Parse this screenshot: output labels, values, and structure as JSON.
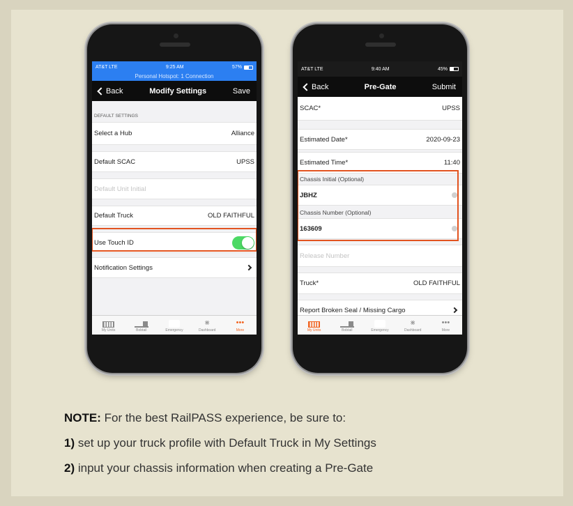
{
  "left_phone": {
    "status": {
      "carrier": "AT&T  LTE",
      "time": "9:25 AM",
      "battery_text": "57%",
      "battery_level": 0.57,
      "hotspot": "Personal Hotspot: 1 Connection"
    },
    "navbar": {
      "back": "Back",
      "title": "Modify Settings",
      "action": "Save"
    },
    "section_header": "DEFAULT SETTINGS",
    "rows": {
      "hub": {
        "label": "Select a Hub",
        "value": "Alliance"
      },
      "scac": {
        "label": "Default SCAC",
        "value": "UPSS"
      },
      "unit_initial": {
        "placeholder": "Default Unit Initial"
      },
      "truck": {
        "label": "Default Truck",
        "value": "OLD FAITHFUL"
      },
      "touch_id": {
        "label": "Use Touch ID",
        "enabled": true
      },
      "notifications": {
        "label": "Notification Settings"
      }
    },
    "tabs": [
      {
        "label": "My Units",
        "icon": "units-icon",
        "active": false
      },
      {
        "label": "Bobtail",
        "icon": "bobtail-icon",
        "active": false
      },
      {
        "label": "Emergency",
        "icon": "emergency-icon",
        "active": false
      },
      {
        "label": "Dashboard",
        "icon": "dashboard-icon",
        "active": false
      },
      {
        "label": "More",
        "icon": "more-icon",
        "active": true
      }
    ]
  },
  "right_phone": {
    "status": {
      "carrier": "AT&T  LTE",
      "time": "9:40 AM",
      "battery_text": "45%",
      "battery_level": 0.45
    },
    "navbar": {
      "back": "Back",
      "title": "Pre-Gate",
      "action": "Submit"
    },
    "rows": {
      "scac": {
        "label": "SCAC*",
        "value": "UPSS"
      },
      "date": {
        "label": "Estimated Date*",
        "value": "2020-09-23"
      },
      "time": {
        "label": "Estimated Time*",
        "value": "11:40"
      },
      "chassis_initial": {
        "label": "Chassis Initial (Optional)",
        "value": "JBHZ"
      },
      "chassis_number": {
        "label": "Chassis Number (Optional)",
        "value": "163609"
      },
      "release": {
        "placeholder": "Release Number"
      },
      "truck": {
        "label": "Truck*",
        "value": "OLD FAITHFUL"
      },
      "report": {
        "label": "Report Broken Seal / Missing Cargo"
      }
    },
    "tabs": [
      {
        "label": "My Units",
        "icon": "units-icon",
        "active": true
      },
      {
        "label": "Bobtail",
        "icon": "bobtail-icon",
        "active": false
      },
      {
        "label": "Emergency",
        "icon": "emergency-icon",
        "active": false
      },
      {
        "label": "Dashboard",
        "icon": "dashboard-icon",
        "active": false
      },
      {
        "label": "More",
        "icon": "more-icon",
        "active": false
      }
    ]
  },
  "note": {
    "heading": "NOTE:",
    "intro": " For the best RailPASS experience, be sure to:",
    "items": [
      {
        "num": "1)",
        "text": " set up your truck profile with Default Truck in My Settings"
      },
      {
        "num": "2)",
        "text": " input your chassis information when creating a Pre-Gate"
      }
    ]
  },
  "colors": {
    "highlight": "#e2531f",
    "accent": "#f26522",
    "status_blue": "#2c7ff1",
    "toggle_on": "#4cd964"
  }
}
